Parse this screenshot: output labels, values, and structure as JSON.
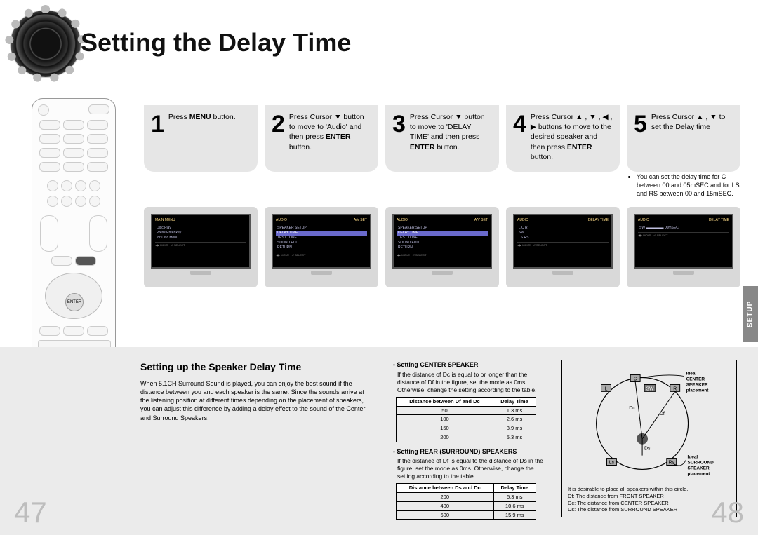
{
  "title": "Setting the Delay Time",
  "setup_tab": "SETUP",
  "page_left": "47",
  "page_right": "48",
  "steps": [
    {
      "num": "1",
      "text": "Press <b>MENU</b> button."
    },
    {
      "num": "2",
      "text": "Press Cursor <span class='arrow'>▼</span> button to move to 'Audio' and then press <b>ENTER</b> button."
    },
    {
      "num": "3",
      "text": "Press Cursor <span class='arrow'>▼</span> button to move to 'DELAY TIME' and then press <b>ENTER</b> button."
    },
    {
      "num": "4",
      "text": "Press Cursor <span class='arrow'>▲</span> , <span class='arrow'>▼</span> , <span class='arrow'>◀</span> , <span class='arrow'>▶</span> buttons to move to the desired speaker and then press <b>ENTER</b> button."
    },
    {
      "num": "5",
      "text": "Press Cursor <span class='arrow'>▲</span> , <span class='arrow'>▼</span> to set the Delay time"
    }
  ],
  "note": "You can set the delay time for C between 00 and 05mSEC and for LS and RS between 00 and 15mSEC.",
  "screens": [
    {
      "title_l": "MAIN MENU",
      "title_r": "",
      "lines": [
        "Disc Play",
        "",
        "Press Enter key",
        "for Disc Menu",
        ""
      ],
      "hi": -1
    },
    {
      "title_l": "AUDIO",
      "title_r": "A/V SET",
      "lines": [
        "SPEAKER SETUP",
        "DELAY TIME",
        "TEST TONE",
        "SOUND EDIT",
        "RETURN"
      ],
      "hi": 1
    },
    {
      "title_l": "AUDIO",
      "title_r": "A/V SET",
      "lines": [
        "SPEAKER SETUP",
        "DELAY TIME",
        "TEST TONE",
        "SOUND EDIT",
        "RETURN"
      ],
      "hi": 1
    },
    {
      "title_l": "AUDIO",
      "title_r": "DELAY TIME",
      "lines": [
        "L  C  R",
        "   SW",
        "LS    RS"
      ],
      "hi": -1
    },
    {
      "title_l": "AUDIO",
      "title_r": "DELAY TIME",
      "lines": [
        "SW   ▬▬▬▬▬ 00mSEC"
      ],
      "hi": -1
    }
  ],
  "lower": {
    "heading": "Setting up the Speaker Delay Time",
    "para": "When 5.1CH Surround Sound is played, you can enjoy the best sound if the distance between you and each speaker is the same. Since the sounds arrive at the listening position at different times depending on the placement of speakers, you can adjust this difference by adding a delay effect to the sound of the Center and Surround Speakers.",
    "center_head": "Setting CENTER SPEAKER",
    "center_text": "If the distance of Dc is equal to or longer than the distance of Df in the figure, set the mode as 0ms. Otherwise, change the setting according to the table.",
    "rear_head": "Setting REAR (SURROUND) SPEAKERS",
    "rear_text": "If the distance of Df is equal to the distance of Ds in the figure, set the mode as 0ms. Otherwise, change the setting according to the table.",
    "diagram_note": "It is desirable to place all speakers within this circle.",
    "diagram_legend": [
      "Df: The distance from FRONT SPEAKER",
      "Dc: The distance from CENTER SPEAKER",
      "Ds: The distance from SURROUND SPEAKER"
    ],
    "label_center_ideal": "Ideal CENTER SPEAKER placement",
    "label_surround_ideal": "Ideal SURROUND SPEAKER placement"
  },
  "chart_data": [
    {
      "type": "table",
      "title": "Distance between Df and Dc",
      "columns": [
        "Distance between Df and Dc",
        "Delay Time"
      ],
      "rows": [
        [
          "50",
          "1.3 ms"
        ],
        [
          "100",
          "2.6 ms"
        ],
        [
          "150",
          "3.9 ms"
        ],
        [
          "200",
          "5.3 ms"
        ]
      ]
    },
    {
      "type": "table",
      "title": "Distance between Ds and Dc",
      "columns": [
        "Distance between Ds and Dc",
        "Delay Time"
      ],
      "rows": [
        [
          "200",
          "5.3 ms"
        ],
        [
          "400",
          "10.6 ms"
        ],
        [
          "600",
          "15.9 ms"
        ]
      ]
    }
  ]
}
